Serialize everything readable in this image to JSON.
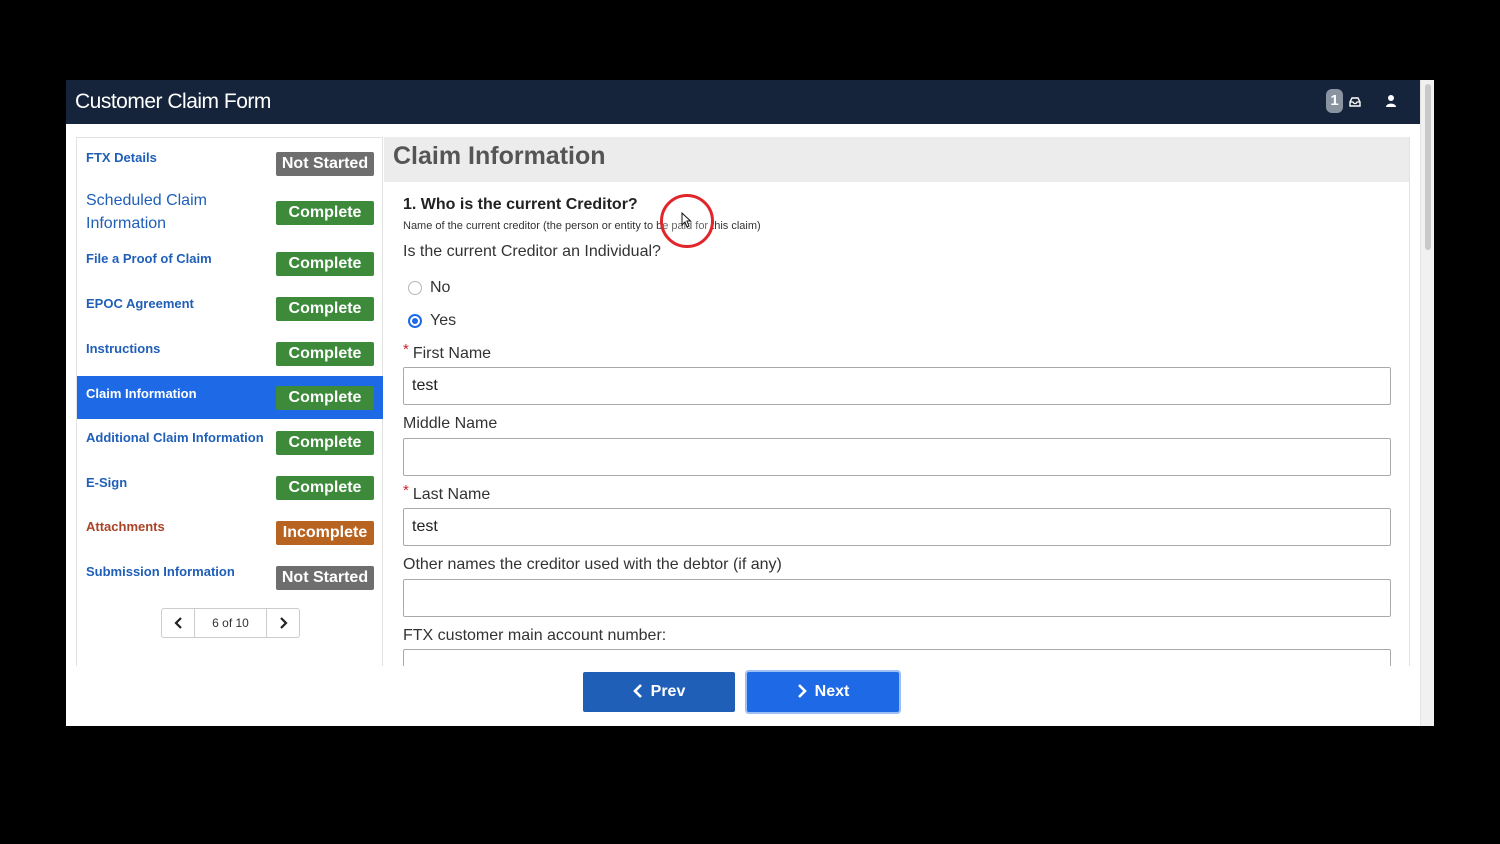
{
  "window": {
    "title": "Customer Claim Form",
    "notification_count": "1"
  },
  "sidebar": {
    "items": [
      {
        "label": "FTX Details",
        "status": "Not Started"
      },
      {
        "label": "Scheduled Claim Information",
        "status": "Complete"
      },
      {
        "label": "File a Proof of Claim",
        "status": "Complete"
      },
      {
        "label": "EPOC Agreement",
        "status": "Complete"
      },
      {
        "label": "Instructions",
        "status": "Complete"
      },
      {
        "label": "Claim Information",
        "status": "Complete"
      },
      {
        "label": "Additional Claim Information",
        "status": "Complete"
      },
      {
        "label": "E-Sign",
        "status": "Complete"
      },
      {
        "label": "Attachments",
        "status": "Incomplete"
      },
      {
        "label": "Submission Information",
        "status": "Not Started"
      }
    ],
    "active_item": "Claim Information",
    "pager": {
      "text": "6 of 10"
    }
  },
  "main": {
    "title": "Claim Information",
    "question_title": "1. Who is the current Creditor?",
    "question_help": "Name of the current creditor (the person or entity to be paid for this claim)",
    "individual_question": "Is the current Creditor an Individual?",
    "options": [
      "No",
      "Yes"
    ],
    "selected_option": "Yes",
    "fields": {
      "first_name": {
        "label": "First Name",
        "value": "test",
        "required": true
      },
      "middle_name": {
        "label": "Middle Name",
        "value": "",
        "required": false
      },
      "last_name": {
        "label": "Last Name",
        "value": "test",
        "required": true
      },
      "other_names": {
        "label": "Other names the creditor used with the debtor (if any)",
        "value": "",
        "required": false
      },
      "account_number": {
        "label": "FTX customer main account number:",
        "value": "",
        "required": false
      }
    }
  },
  "footer": {
    "prev_label": "Prev",
    "next_label": "Next"
  },
  "colors": {
    "header_bg": "#15243a",
    "accent": "#1e6ae6",
    "complete": "#3c8a3a",
    "not_started": "#6e6e6e",
    "incomplete": "#b86320"
  }
}
